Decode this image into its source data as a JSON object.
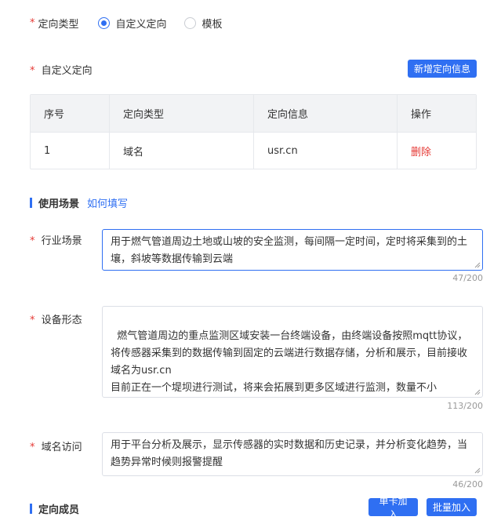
{
  "targeting_type": {
    "label": "定向类型",
    "options": [
      {
        "label": "自定义定向",
        "checked": true
      },
      {
        "label": "模板",
        "checked": false
      }
    ]
  },
  "custom_targeting": {
    "label": "自定义定向",
    "add_button": "新增定向信息",
    "columns": [
      "序号",
      "定向类型",
      "定向信息",
      "操作"
    ],
    "rows": [
      {
        "index": "1",
        "type": "域名",
        "info": "usr.cn",
        "action": "删除"
      }
    ]
  },
  "usage_section": {
    "title": "使用场景",
    "help_link": "如何填写"
  },
  "industry": {
    "label": "行业场景",
    "value": "用于燃气管道周边土地或山坡的安全监测，每间隔一定时间，定时将采集到的土壤，斜坡等数据传输到云端",
    "counter": "47/200"
  },
  "device": {
    "label": "设备形态",
    "value": "燃气管道周边的重点监测区域安装一台终端设备，由终端设备按照mqtt协议，将传感器采集到的数据传输到固定的云端进行数据存储，分析和展示，目前接收域名为usr.cn\n目前正在一个堤坝进行测试，将来会拓展到更多区域进行监测，数量不小",
    "counter": "113/200"
  },
  "domain_access": {
    "label": "域名访问",
    "value": "用于平台分析及展示，显示传感器的实时数据和历史记录，并分析变化趋势，当趋势异常时候则报警提醒",
    "counter": "46/200"
  },
  "members_section": {
    "title": "定向成员",
    "single_add": "单卡加入",
    "batch_add": "批量加入"
  },
  "colors": {
    "primary": "#2f6ff2",
    "danger": "#e53935"
  }
}
